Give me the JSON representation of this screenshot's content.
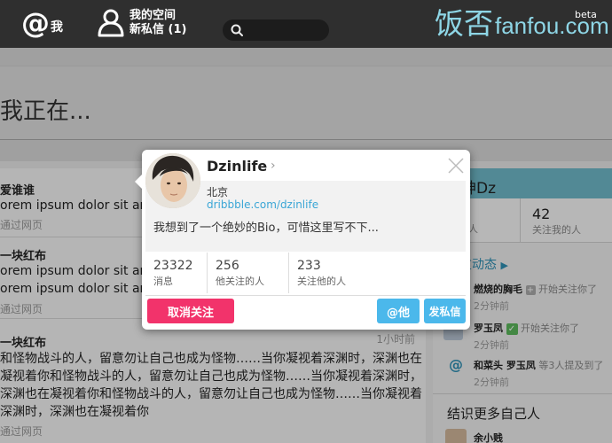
{
  "header": {
    "me_label": "我",
    "space_label": "我的空间",
    "messages_label": "新私信 (1)",
    "search_placeholder": "",
    "logo_cn": "饭否",
    "logo_en": "fanfou.com",
    "logo_beta": "beta"
  },
  "status_box": {
    "placeholder": "我正在..."
  },
  "timeline": [
    {
      "user": "爱谁谁",
      "text": "orem ipsum dolor sit am",
      "source": "通过网页",
      "time": ""
    },
    {
      "user": "一块红布",
      "text": "orem ipsum dolor sit am",
      "source": "通过网页",
      "time": ""
    },
    {
      "user": "一块红布",
      "text_lines": [
        "和怪物战斗的人，留意勿让自己也成为怪物……当你凝视着深渊时，深渊也在",
        "凝视着你和怪物战斗的人，留意勿让自己也成为怪物……当你凝视着深渊时，",
        "深渊也在凝视着你和怪物战斗的人，留意勿让自己也成为怪物……当你凝视着",
        "深渊时，深渊也在凝视着你"
      ],
      "source": "通过网页",
      "time": "1小时前"
    }
  ],
  "sidebar": {
    "name": "神Dz",
    "stats": [
      {
        "num": "",
        "label": "注的人"
      },
      {
        "num": "42",
        "label": "关注我的人"
      }
    ],
    "activity_title": "友动态",
    "activities": [
      {
        "actor": "燃烧的胸毛",
        "verb": "开始关注你了",
        "time": "2分钟前"
      },
      {
        "actor": "罗玉凤",
        "verb": "开始关注你了",
        "time": "2分钟前"
      },
      {
        "actor": "和菜头 罗玉凤",
        "verb": "等3人提及到了",
        "time": "2分钟前"
      }
    ],
    "more_title": "结识更多自己人",
    "more_user": "余小贱"
  },
  "card": {
    "name": "Dzinlife",
    "location": "北京",
    "url": "dribbble.com/dzinlife",
    "bio": "我想到了一个绝妙的Bio，可惜这里写不下...",
    "stats": [
      {
        "num": "23322",
        "label": "消息"
      },
      {
        "num": "256",
        "label": "他关注的人"
      },
      {
        "num": "233",
        "label": "关注他的人"
      }
    ],
    "unfollow_label": "取消关注",
    "mention_label": "@他",
    "dm_label": "发私信"
  },
  "colors": {
    "accent_pink": "#f2336b",
    "accent_blue": "#4bb8eb",
    "logo": "#8ed6e6",
    "topbar": "#2f2f2f"
  }
}
